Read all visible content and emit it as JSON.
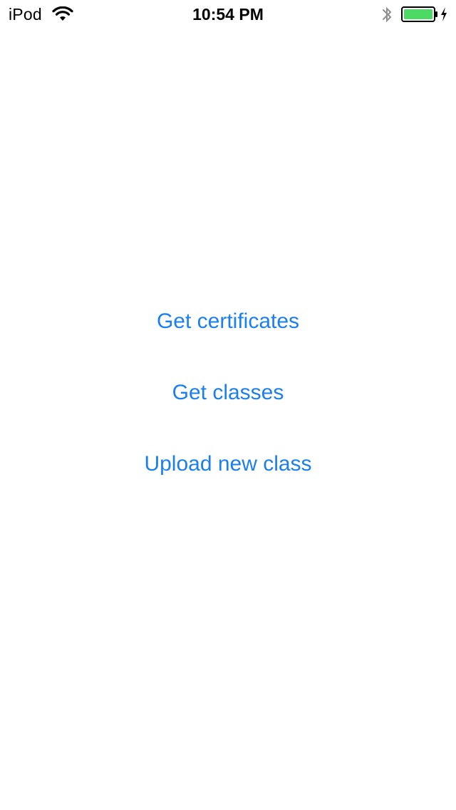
{
  "status_bar": {
    "carrier": "iPod",
    "time": "10:54 PM",
    "wifi_icon": "wifi-icon",
    "bluetooth_icon": "bluetooth-icon",
    "battery_icon": "battery-icon",
    "charging_icon": "charging-bolt-icon",
    "battery_color": "#4cd964",
    "battery_level": 1
  },
  "main": {
    "actions": [
      {
        "label": "Get certificates"
      },
      {
        "label": "Get classes"
      },
      {
        "label": "Upload new class"
      }
    ],
    "action_color": "#1a7ff0"
  }
}
